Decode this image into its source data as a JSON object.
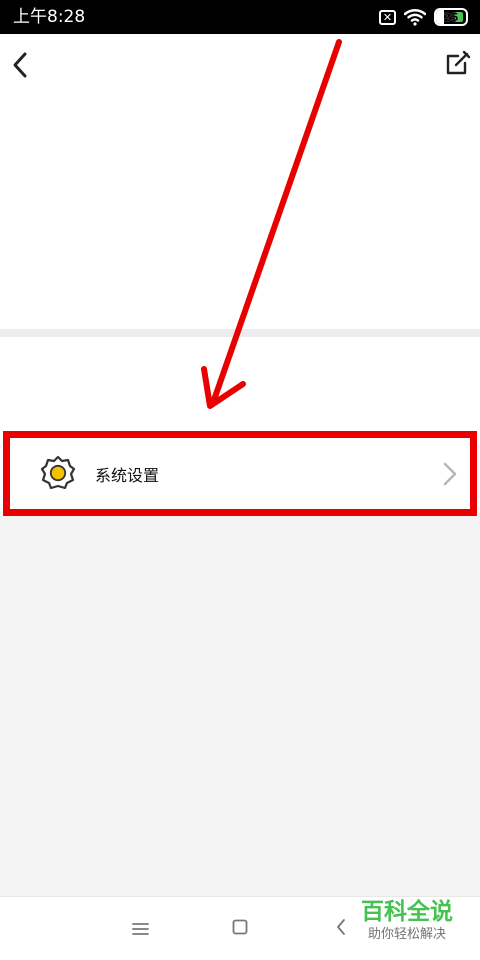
{
  "status_bar": {
    "time": "上午8:28",
    "sim_symbol": "✕",
    "battery_level": "25"
  },
  "top_bar": {
    "back_icon": "chevron-left-icon",
    "edit_icon": "edit-icon"
  },
  "settings": {
    "label": "系统设置",
    "icon": "gear-icon",
    "chevron_icon": "chevron-right-icon"
  },
  "navigation": {
    "menu_icon": "menu-icon",
    "home_icon": "home-icon",
    "back_icon": "back-icon"
  },
  "watermark": {
    "title": "百科全说",
    "subtitle": "助你轻松解决"
  },
  "colors": {
    "highlight": "#e90000",
    "arrow": "#e90000",
    "gear_center": "#f2c200",
    "battery_accent": "#49c651",
    "watermark_green": "#46c250"
  }
}
